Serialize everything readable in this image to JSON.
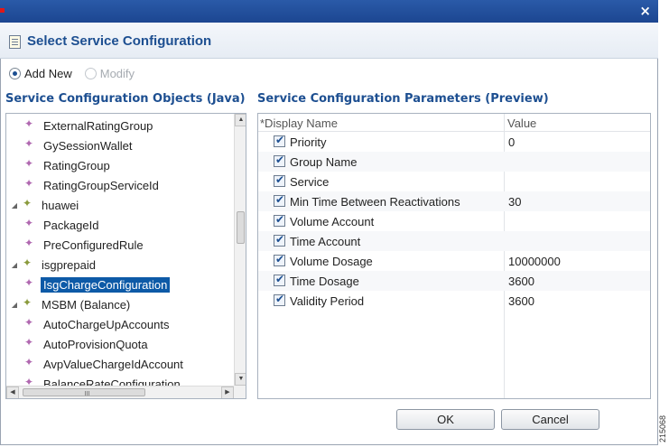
{
  "window": {
    "close_glyph": "×"
  },
  "dialog": {
    "title": "Select Service Configuration"
  },
  "mode": {
    "options": [
      {
        "label": "Add New",
        "checked": true,
        "enabled": true
      },
      {
        "label": "Modify",
        "checked": false,
        "enabled": false
      }
    ]
  },
  "objects_panel": {
    "title": "Service Configuration Objects (Java)",
    "items": [
      {
        "label": "ExternalRatingGroup",
        "kind": "class",
        "level": 1
      },
      {
        "label": "GySessionWallet",
        "kind": "class",
        "level": 1
      },
      {
        "label": "RatingGroup",
        "kind": "class",
        "level": 1
      },
      {
        "label": "RatingGroupServiceId",
        "kind": "class",
        "level": 1
      },
      {
        "label": "huawei",
        "kind": "package",
        "level": 0
      },
      {
        "label": "PackageId",
        "kind": "class",
        "level": 1
      },
      {
        "label": "PreConfiguredRule",
        "kind": "class",
        "level": 1
      },
      {
        "label": "isgprepaid",
        "kind": "package",
        "level": 0
      },
      {
        "label": "IsgChargeConfiguration",
        "kind": "class",
        "level": 1,
        "selected": true
      },
      {
        "label": "MSBM (Balance)",
        "kind": "package",
        "level": 0
      },
      {
        "label": "AutoChargeUpAccounts",
        "kind": "class",
        "level": 1
      },
      {
        "label": "AutoProvisionQuota",
        "kind": "class",
        "level": 1
      },
      {
        "label": "AvpValueChargeIdAccount",
        "kind": "class",
        "level": 1
      },
      {
        "label": "BalanceRateConfiguration",
        "kind": "class",
        "level": 1
      }
    ]
  },
  "params_panel": {
    "title": "Service Configuration Parameters (Preview)",
    "col_name": "*Display Name",
    "col_value": "Value",
    "rows": [
      {
        "name": "Priority",
        "value": "0",
        "checked": true
      },
      {
        "name": "Group Name",
        "value": "",
        "checked": true
      },
      {
        "name": "Service",
        "value": "",
        "checked": true
      },
      {
        "name": "Min Time Between Reactivations",
        "value": "30",
        "checked": true
      },
      {
        "name": "Volume Account",
        "value": "",
        "checked": true
      },
      {
        "name": "Time Account",
        "value": "",
        "checked": true
      },
      {
        "name": "Volume Dosage",
        "value": "10000000",
        "checked": true
      },
      {
        "name": "Time Dosage",
        "value": "3600",
        "checked": true
      },
      {
        "name": "Validity Period",
        "value": "3600",
        "checked": true
      }
    ]
  },
  "buttons": {
    "ok": "OK",
    "cancel": "Cancel"
  },
  "figure_tag": "215068"
}
